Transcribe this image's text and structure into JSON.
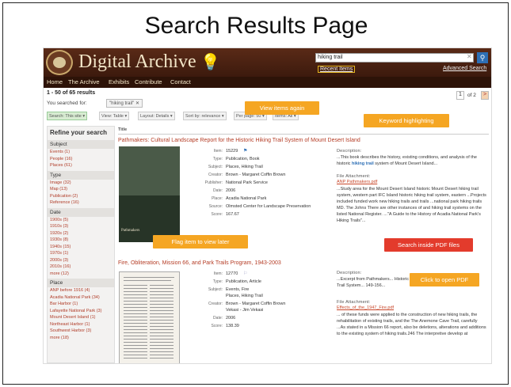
{
  "slide": {
    "title": "Search Results Page"
  },
  "header": {
    "site_name": "Digital Archive",
    "search_value": "hiking trail",
    "recent_items": "Recent Items",
    "advanced_search": "Advanced Search"
  },
  "nav": {
    "items": [
      "Home",
      "The Archive",
      "Exhibits",
      "Contribute",
      "Contact"
    ]
  },
  "results": {
    "count": "1 - 50 of 65 results",
    "searched_for": "You searched for:",
    "query_chip": "\"hiking trail\" ✕",
    "page_current": "1",
    "page_of": "of 2",
    "page_next": ">"
  },
  "toolbar": {
    "search": "Search: This site ▾",
    "view": "View: Table ▾",
    "layout": "Layout: Details ▾",
    "sort": "Sort by: relevance ▾",
    "per_page": "Per page: 50 ▾",
    "items": "Items: All ▾"
  },
  "sidebar": {
    "title": "Refine your search",
    "facets": [
      {
        "name": "Subject",
        "items": [
          "Events (1)",
          "People (16)",
          "Places (61)"
        ]
      },
      {
        "name": "Type",
        "items": [
          "Image (32)",
          "Map (13)",
          "Publication (2)",
          "Reference (16)"
        ]
      },
      {
        "name": "Date",
        "items": [
          "1900s (5)",
          "1910s (3)",
          "1920s (2)",
          "1930s (8)",
          "1940s (15)",
          "1970s (1)",
          "2000s (3)",
          "2010s (16)",
          "more (12)"
        ]
      },
      {
        "name": "Place",
        "items": [
          "ANP before 1916 (4)",
          "Acadia National Park (34)",
          "Bar Harbor (1)",
          "Lafayette National Park (3)",
          "Mount Desert Island (1)",
          "Northeast Harbor (1)",
          "Southwest Harbor (3)",
          "more (18)"
        ]
      }
    ]
  },
  "list_header": "Title",
  "result1": {
    "title": "Pathmakers: Cultural Landscape Report for the Historic Hiking Trail System of Mount Desert Island",
    "thumb_caption": "Pathmakers",
    "meta": [
      {
        "label": "Item:",
        "value": "15229"
      },
      {
        "label": "Type:",
        "value": "Publication, Book"
      },
      {
        "label": "Subject:",
        "value": "Places, Hiking Trail"
      },
      {
        "label": "Creator:",
        "value": "Brown - Margaret Coffin Brown"
      },
      {
        "label": "Publisher:",
        "value": "National Park Service"
      },
      {
        "label": "Date:",
        "value": "2006"
      },
      {
        "label": "Place:",
        "value": "Acadia National Park"
      },
      {
        "label": "Source:",
        "value": "Olmsted Center for Landscape Preservation"
      },
      {
        "label": "Score:",
        "value": "167.67"
      }
    ],
    "desc_label": "Description:",
    "desc_pre": "...This book describes the history, existing conditions, and analysis of the historic ",
    "desc_hl": "hiking trail",
    "desc_post": " system of Mount Desert Island...",
    "attach_label": "File Attachment:",
    "attach_file": "ANP Pathmakers.pdf",
    "attach_text": "...Study area for the Mount Desert Island historic Mount Desert hiking trail system, western part IFC Island historic hiking trail system, eastern ...Projects included funded work new hiking trails and trails ...national park hiking trails MD. The Johns There are other instances of and hiking trail systems on the listed National Register. ...\"A Guide to the History of Acadia National Park's Hiking Trails\"..."
  },
  "result2": {
    "title": "Fire, Obliteration, Mission 66, and Park Trails Program, 1943-2003",
    "meta": [
      {
        "label": "Item:",
        "value": "12770"
      },
      {
        "label": "Type:",
        "value": "Publication, Article"
      },
      {
        "label": "Subject:",
        "value": "Events, Fire"
      },
      {
        "label": "",
        "value": "Places, Hiking Trail"
      },
      {
        "label": "Creator:",
        "value": "Brown - Margaret Coffin Brown"
      },
      {
        "label": "",
        "value": "Vekasi - Jim Vekasi"
      },
      {
        "label": "Date:",
        "value": "2006"
      },
      {
        "label": "Score:",
        "value": "138.39"
      }
    ],
    "desc_label": "Description:",
    "desc_text": "...Excerpt from Pathmakers... Historic Hiking Trail System... 149-156...",
    "attach_label": "File Attachment:",
    "attach_file": "Effects_of_the_1947_Fire.pdf",
    "attach_text": "... of these funds were applied to the construction of new hiking trails, the rehabilitation of existing trails, and the The Anemone Cave Trail, carefully ...As stated in a Mission 66 report, also be deletions, alterations and additions to the existing system of hiking trails.246 The interpretive develop at"
  },
  "callouts": {
    "view_again": "View items again",
    "keyword": "Keyword highlighting",
    "flag": "Flag item to view later",
    "pdf_search": "Search inside PDF files",
    "open_pdf": "Click to open PDF"
  },
  "colors": {
    "header_brown": "#4a200f",
    "callout_orange": "#f5a623",
    "callout_red": "#e33b2c",
    "link_red": "#b53d26",
    "highlight_blue": "#2d6fb5"
  }
}
